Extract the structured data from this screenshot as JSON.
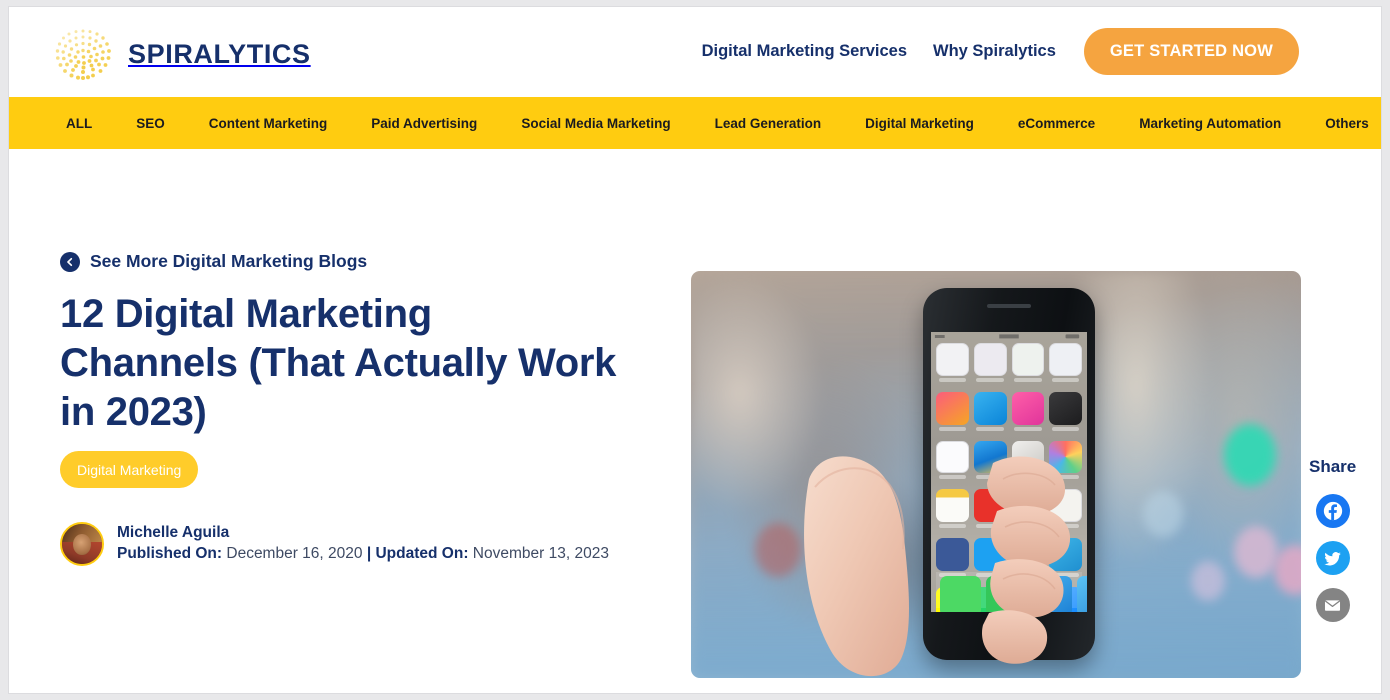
{
  "brand": {
    "name": "SPIRALYTICS",
    "logo_icon": "spiral-dots-logo",
    "navy": "#16306b",
    "yellow": "#ffcc10",
    "orange": "#f5a440"
  },
  "header": {
    "nav": [
      {
        "label": "Digital Marketing Services",
        "name": "nav-digital-marketing-services"
      },
      {
        "label": "Why Spiralytics",
        "name": "nav-why-spiralytics"
      }
    ],
    "cta_label": "GET STARTED NOW"
  },
  "categorybar": {
    "items": [
      {
        "label": "ALL"
      },
      {
        "label": "SEO"
      },
      {
        "label": "Content Marketing"
      },
      {
        "label": "Paid Advertising"
      },
      {
        "label": "Social Media Marketing"
      },
      {
        "label": "Lead Generation"
      },
      {
        "label": "Digital Marketing"
      },
      {
        "label": "eCommerce"
      },
      {
        "label": "Marketing Automation"
      },
      {
        "label": "Others"
      }
    ],
    "search_icon": "search-icon"
  },
  "article": {
    "back_link": "See More Digital Marketing Blogs",
    "back_icon": "chevron-left-circle-icon",
    "title": "12 Digital Marketing Channels (That Actually Work in 2023)",
    "tag": "Digital Marketing",
    "author": "Michelle Aguila",
    "published_label": "Published On:",
    "published_date": "December 16, 2020",
    "separator": "|",
    "updated_label": "Updated On:",
    "updated_date": "November 13, 2023",
    "hero_alt": "hand-holding-smartphone-photo"
  },
  "share": {
    "title": "Share",
    "buttons": [
      {
        "name": "share-facebook-button",
        "icon": "facebook-icon",
        "color": "#1877f2"
      },
      {
        "name": "share-twitter-button",
        "icon": "twitter-icon",
        "color": "#1da1f2"
      },
      {
        "name": "share-email-button",
        "icon": "email-icon",
        "color": "#848484"
      }
    ]
  }
}
